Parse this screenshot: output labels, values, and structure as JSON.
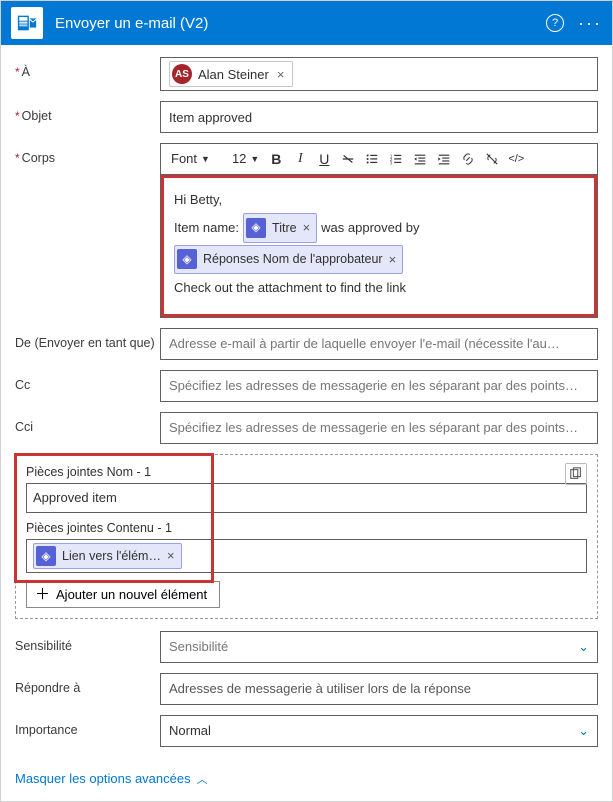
{
  "header": {
    "title": "Envoyer un e-mail (V2)"
  },
  "to": {
    "label": "À",
    "chipInitials": "AS",
    "chipName": "Alan Steiner"
  },
  "subject": {
    "label": "Objet",
    "value": "Item approved"
  },
  "body": {
    "label": "Corps",
    "toolbar": {
      "fontLabel": "Font",
      "sizeLabel": "12"
    },
    "greeting": "Hi Betty,",
    "line2_prefix": "Item name:",
    "token_titre": "Titre",
    "line2_suffix": "was approved by",
    "token_approver": "Réponses Nom de l'approbateur",
    "line4": "Check out the attachment to find the link"
  },
  "from": {
    "label": "De (Envoyer en tant que)",
    "placeholder": "Adresse e-mail à partir de laquelle envoyer l'e-mail (nécessite l'au…"
  },
  "cc": {
    "label": "Cc",
    "placeholder": "Spécifiez les adresses de messagerie en les séparant par des points…"
  },
  "bcc": {
    "label": "Cci",
    "placeholder": "Spécifiez les adresses de messagerie en les séparant par des points…"
  },
  "attach": {
    "nameLabel": "Pièces jointes Nom - 1",
    "nameValue": "Approved item",
    "contentLabel": "Pièces jointes Contenu - 1",
    "contentToken": "Lien vers l'élém…",
    "addLabel": "Ajouter un nouvel élément"
  },
  "sensitivity": {
    "label": "Sensibilité",
    "placeholder": "Sensibilité"
  },
  "replyTo": {
    "label": "Répondre à",
    "placeholder": "Adresses de messagerie à utiliser lors de la réponse"
  },
  "importance": {
    "label": "Importance",
    "value": "Normal"
  },
  "footer": {
    "toggleLabel": "Masquer les options avancées"
  }
}
